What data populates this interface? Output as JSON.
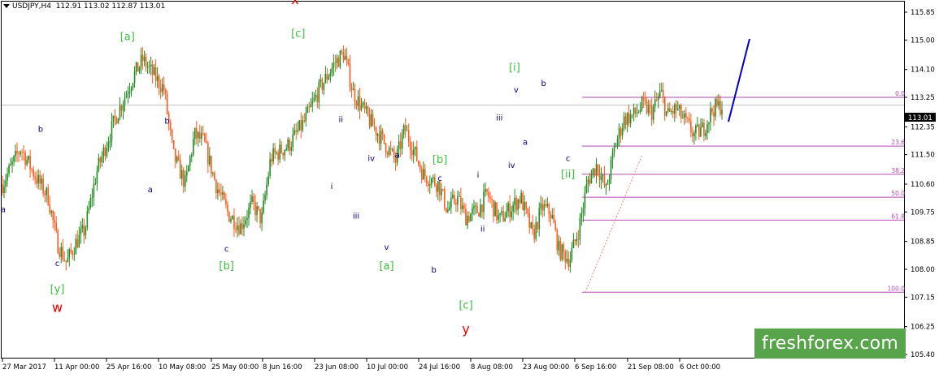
{
  "header": {
    "symbol": "USDJPY,H4",
    "ohlc": "112.91 113.02 112.87 113.01"
  },
  "current_price_label": "113.01",
  "logo_text": "freshforex.com",
  "colors": {
    "price_line": "#c0c0c0",
    "candles_up": "#228b22",
    "candles_down": "#ff5a1e",
    "fib": "#b54ab5",
    "forecast": "#0000cc",
    "wave_red": "#e00000",
    "wave_green": "#3cbf3c",
    "wave_navy": "#000080"
  },
  "chart_data": {
    "type": "candlestick",
    "symbol": "USDJPY",
    "timeframe": "H4",
    "ylim": [
      105.4,
      116.6
    ],
    "y_ticks": [
      "115.85",
      "115.00",
      "114.10",
      "113.25",
      "112.35",
      "111.50",
      "110.60",
      "109.75",
      "108.85",
      "108.00",
      "107.15",
      "106.25",
      "105.40"
    ],
    "x_ticks": [
      "27 Mar 2017",
      "11 Apr 00:00",
      "25 Apr 16:00",
      "10 May 08:00",
      "25 May 00:00",
      "8 Jun 16:00",
      "23 Jun 08:00",
      "10 Jul 00:00",
      "24 Jul 16:00",
      "8 Aug 08:00",
      "23 Aug 00:00",
      "6 Sep 16:00",
      "21 Sep 08:00",
      "6 Oct 00:00"
    ],
    "current_price": 113.01,
    "price_path": [
      [
        0,
        110.6
      ],
      [
        1.2,
        111.7
      ],
      [
        2.2,
        110.8
      ],
      [
        3.0,
        110.2
      ],
      [
        3.6,
        108.8
      ],
      [
        4.2,
        108.2
      ],
      [
        4.8,
        108.8
      ],
      [
        5.4,
        109.2
      ],
      [
        6.2,
        111.0
      ],
      [
        7.4,
        112.6
      ],
      [
        8.6,
        113.9
      ],
      [
        9.2,
        114.4
      ],
      [
        9.8,
        114.0
      ],
      [
        10.6,
        113.5
      ],
      [
        11.2,
        111.5
      ],
      [
        12.0,
        110.6
      ],
      [
        12.6,
        112.1
      ],
      [
        13.2,
        111.9
      ],
      [
        14.0,
        110.6
      ],
      [
        14.8,
        109.7
      ],
      [
        15.6,
        109.3
      ],
      [
        16.4,
        110.0
      ],
      [
        17.0,
        109.5
      ],
      [
        17.6,
        111.4
      ],
      [
        18.8,
        111.8
      ],
      [
        19.8,
        112.5
      ],
      [
        20.8,
        113.5
      ],
      [
        21.8,
        114.3
      ],
      [
        22.4,
        114.6
      ],
      [
        23.0,
        113.4
      ],
      [
        24.0,
        112.6
      ],
      [
        25.0,
        111.9
      ],
      [
        25.8,
        111.3
      ],
      [
        26.4,
        112.3
      ],
      [
        27.0,
        111.6
      ],
      [
        27.6,
        110.9
      ],
      [
        28.6,
        110.6
      ],
      [
        29.2,
        109.8
      ],
      [
        29.8,
        110.2
      ],
      [
        30.4,
        109.6
      ],
      [
        31.2,
        109.8
      ],
      [
        31.8,
        110.3
      ],
      [
        32.6,
        109.5
      ],
      [
        33.4,
        109.9
      ],
      [
        34.0,
        110.2
      ],
      [
        34.8,
        109.0
      ],
      [
        35.4,
        109.9
      ],
      [
        36.0,
        109.7
      ],
      [
        36.5,
        108.6
      ],
      [
        37.2,
        108.3
      ],
      [
        37.8,
        109.2
      ],
      [
        38.4,
        110.7
      ],
      [
        39.0,
        111.2
      ],
      [
        39.6,
        110.4
      ],
      [
        40.2,
        111.8
      ],
      [
        40.8,
        112.6
      ],
      [
        41.4,
        112.7
      ],
      [
        42.0,
        113.0
      ],
      [
        42.6,
        112.8
      ],
      [
        43.2,
        113.4
      ],
      [
        43.6,
        112.7
      ],
      [
        44.2,
        112.9
      ],
      [
        44.8,
        112.5
      ],
      [
        45.4,
        112.1
      ],
      [
        46.0,
        112.3
      ],
      [
        46.6,
        112.9
      ],
      [
        47.2,
        113.01
      ]
    ],
    "fibonacci": [
      {
        "level": "0.0",
        "price": 113.25
      },
      {
        "level": "23.6",
        "price": 111.76
      },
      {
        "level": "38.2",
        "price": 110.9
      },
      {
        "level": "50.0",
        "price": 110.2
      },
      {
        "level": "61.8",
        "price": 109.5
      },
      {
        "level": "100.0",
        "price": 107.3
      }
    ],
    "forecast_line": {
      "from": [
        47.4,
        112.9
      ],
      "to": [
        49.2,
        115.5
      ]
    },
    "annotations": [
      {
        "text": "a",
        "x": 0.05,
        "price": 109.75,
        "style": "navy"
      },
      {
        "text": "b",
        "x": 2.5,
        "price": 112.2,
        "style": "navy"
      },
      {
        "text": "c",
        "x": 3.6,
        "price": 108.1,
        "style": "navy"
      },
      {
        "text": "[y]",
        "x": 3.6,
        "price": 107.3,
        "style": "green"
      },
      {
        "text": "w",
        "x": 3.6,
        "price": 106.7,
        "style": "red"
      },
      {
        "text": "[a]",
        "x": 8.2,
        "price": 115.0,
        "style": "green"
      },
      {
        "text": "a",
        "x": 9.7,
        "price": 110.35,
        "style": "navy"
      },
      {
        "text": "b",
        "x": 10.8,
        "price": 112.45,
        "style": "navy"
      },
      {
        "text": "c",
        "x": 14.7,
        "price": 108.55,
        "style": "navy"
      },
      {
        "text": "[b]",
        "x": 14.7,
        "price": 108.0,
        "style": "green"
      },
      {
        "text": "x",
        "x": 19.2,
        "price": 116.1,
        "style": "red"
      },
      {
        "text": "[c]",
        "x": 19.4,
        "price": 115.1,
        "style": "green"
      },
      {
        "text": "ii",
        "x": 22.2,
        "price": 112.5,
        "style": "navy"
      },
      {
        "text": "i",
        "x": 21.6,
        "price": 110.45,
        "style": "navy"
      },
      {
        "text": "iv",
        "x": 24.2,
        "price": 111.3,
        "style": "navy"
      },
      {
        "text": "iii",
        "x": 23.2,
        "price": 109.55,
        "style": "navy"
      },
      {
        "text": "a",
        "x": 25.9,
        "price": 111.4,
        "style": "navy"
      },
      {
        "text": "v",
        "x": 25.2,
        "price": 108.6,
        "style": "navy"
      },
      {
        "text": "[a]",
        "x": 25.2,
        "price": 108.0,
        "style": "green"
      },
      {
        "text": "c",
        "x": 28.7,
        "price": 110.7,
        "style": "navy"
      },
      {
        "text": "[b]",
        "x": 28.7,
        "price": 111.25,
        "style": "green"
      },
      {
        "text": "b",
        "x": 28.3,
        "price": 107.9,
        "style": "navy"
      },
      {
        "text": "[c]",
        "x": 30.4,
        "price": 106.8,
        "style": "green"
      },
      {
        "text": "y",
        "x": 30.4,
        "price": 106.05,
        "style": "red"
      },
      {
        "text": "i",
        "x": 31.2,
        "price": 110.8,
        "style": "navy"
      },
      {
        "text": "ii",
        "x": 31.5,
        "price": 109.15,
        "style": "navy"
      },
      {
        "text": "iii",
        "x": 32.6,
        "price": 112.55,
        "style": "navy"
      },
      {
        "text": "iv",
        "x": 33.4,
        "price": 111.1,
        "style": "navy"
      },
      {
        "text": "[i]",
        "x": 33.6,
        "price": 114.05,
        "style": "green"
      },
      {
        "text": "v",
        "x": 33.7,
        "price": 113.4,
        "style": "navy"
      },
      {
        "text": "a",
        "x": 34.3,
        "price": 111.8,
        "style": "navy"
      },
      {
        "text": "b",
        "x": 35.5,
        "price": 113.6,
        "style": "navy"
      },
      {
        "text": "c",
        "x": 37.1,
        "price": 111.3,
        "style": "navy"
      },
      {
        "text": "[ii]",
        "x": 37.1,
        "price": 110.8,
        "style": "green"
      }
    ]
  }
}
